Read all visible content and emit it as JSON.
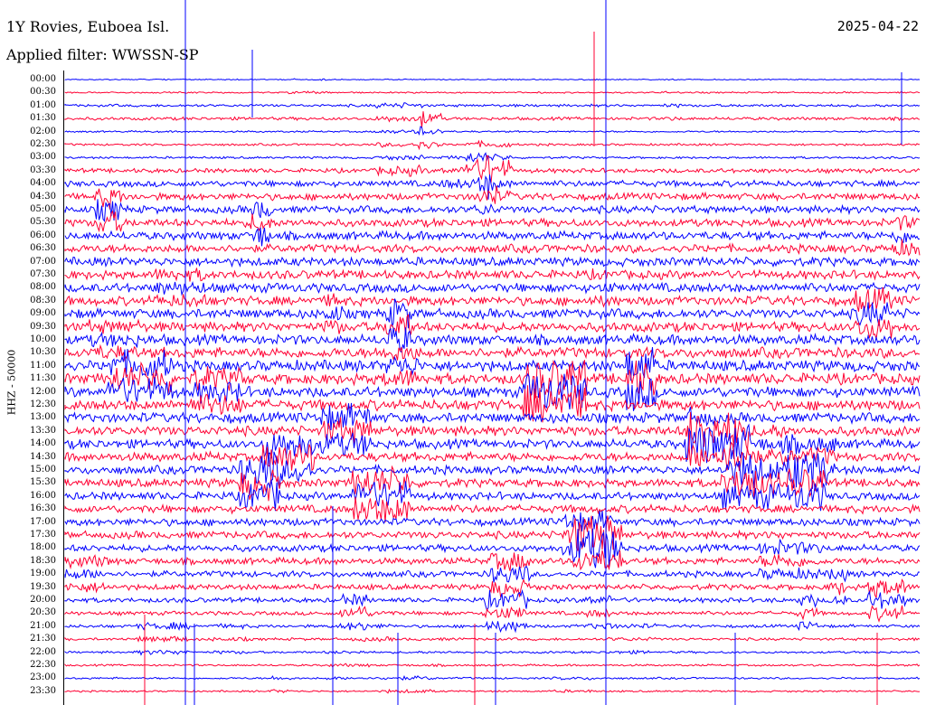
{
  "header": {
    "station": "1Y Rovies, Euboea Isl.",
    "date": "2025-04-22",
    "filter": "Applied filter: WWSSN-SP",
    "channel": "HHZ - 50000"
  },
  "chart_data": {
    "type": "line",
    "title": "1Y Rovies, Euboea Isl.",
    "subtitle": "Applied filter: WWSSN-SP",
    "ylabel": "HHZ - 50000",
    "xlabel": "",
    "row_labels": [
      "00:00",
      "00:30",
      "01:00",
      "01:30",
      "02:00",
      "02:30",
      "03:00",
      "03:30",
      "04:00",
      "04:30",
      "05:00",
      "05:30",
      "06:00",
      "06:30",
      "07:00",
      "07:30",
      "08:00",
      "08:30",
      "09:00",
      "09:30",
      "10:00",
      "10:30",
      "11:00",
      "11:30",
      "12:00",
      "12:30",
      "13:00",
      "13:30",
      "14:00",
      "14:30",
      "15:00",
      "15:30",
      "16:00",
      "16:30",
      "17:00",
      "17:30",
      "18:00",
      "18:30",
      "19:00",
      "19:30",
      "20:00",
      "20:30",
      "21:00",
      "21:30",
      "22:00",
      "22:30",
      "23:00",
      "23:30"
    ],
    "row_colors": [
      "#0000ff",
      "#ff0033"
    ],
    "row_activity": [
      0.25,
      0.35,
      0.6,
      0.7,
      0.4,
      0.5,
      0.5,
      1.0,
      1.4,
      1.6,
      1.7,
      1.8,
      1.9,
      1.9,
      2.0,
      2.0,
      2.1,
      2.1,
      2.2,
      2.2,
      2.3,
      2.4,
      2.5,
      2.5,
      2.4,
      2.4,
      2.3,
      2.2,
      2.1,
      2.0,
      1.9,
      1.9,
      1.8,
      1.8,
      1.7,
      1.7,
      1.6,
      1.5,
      1.4,
      1.3,
      1.1,
      0.9,
      0.7,
      0.6,
      0.5,
      0.45,
      0.45,
      0.4
    ],
    "grid": false,
    "legend": "none"
  }
}
